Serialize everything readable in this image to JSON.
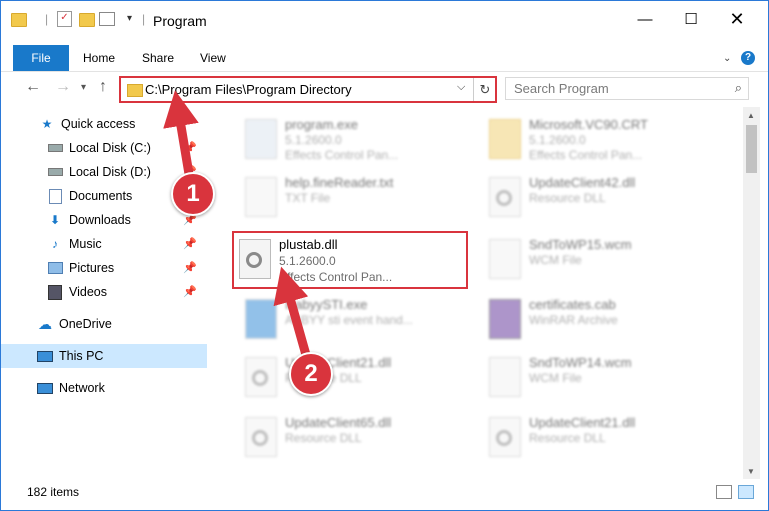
{
  "window": {
    "title": "Program"
  },
  "ribbon": {
    "file": "File",
    "tabs": [
      "Home",
      "Share",
      "View"
    ],
    "help": "?"
  },
  "address": {
    "path": "C:\\Program Files\\Program Directory"
  },
  "search": {
    "placeholder": "Search Program"
  },
  "sidebar": {
    "items": [
      {
        "label": "Quick access",
        "icon": "star-icon"
      },
      {
        "label": "Local Disk (C:)",
        "icon": "drive-icon"
      },
      {
        "label": "Local Disk (D:)",
        "icon": "drive-icon"
      },
      {
        "label": "Documents",
        "icon": "documents-icon"
      },
      {
        "label": "Downloads",
        "icon": "download-icon"
      },
      {
        "label": "Music",
        "icon": "music-icon"
      },
      {
        "label": "Pictures",
        "icon": "pictures-icon"
      },
      {
        "label": "Videos",
        "icon": "videos-icon"
      },
      {
        "label": "OneDrive",
        "icon": "cloud-icon"
      },
      {
        "label": "This PC",
        "icon": "computer-icon"
      },
      {
        "label": "Network",
        "icon": "network-icon"
      }
    ]
  },
  "files": [
    {
      "name": "program.exe",
      "line2": "5.1.2600.0",
      "line3": "Effects Control Pan..."
    },
    {
      "name": "Microsoft.VC90.CRT",
      "line2": "5.1.2600.0",
      "line3": "Effects Control Pan..."
    },
    {
      "name": "help.fineReader.txt",
      "line2": "TXT File",
      "line3": ""
    },
    {
      "name": "UpdateClient42.dll",
      "line2": "Resource DLL",
      "line3": ""
    },
    {
      "name": "plustab.dll",
      "line2": "5.1.2600.0",
      "line3": "Effects Control Pan..."
    },
    {
      "name": "SndToWP15.wcm",
      "line2": "WCM File",
      "line3": ""
    },
    {
      "name": "IsabyySTI.exe",
      "line2": "ABBYY sti event hand...",
      "line3": ""
    },
    {
      "name": "certificates.cab",
      "line2": "WinRAR Archive",
      "line3": ""
    },
    {
      "name": "UpdateClient21.dll",
      "line2": "Resource DLL",
      "line3": ""
    },
    {
      "name": "SndToWP14.wcm",
      "line2": "WCM File",
      "line3": ""
    },
    {
      "name": "UpdateClient65.dll",
      "line2": "Resource DLL",
      "line3": ""
    },
    {
      "name": "UpdateClient21.dll",
      "line2": "Resource DLL",
      "line3": ""
    }
  ],
  "status": {
    "count": "182 items"
  },
  "annotations": {
    "step1": "1",
    "step2": "2"
  },
  "colors": {
    "accent": "#1979ca",
    "annotation": "#d9343d",
    "selection": "#cce8ff"
  }
}
